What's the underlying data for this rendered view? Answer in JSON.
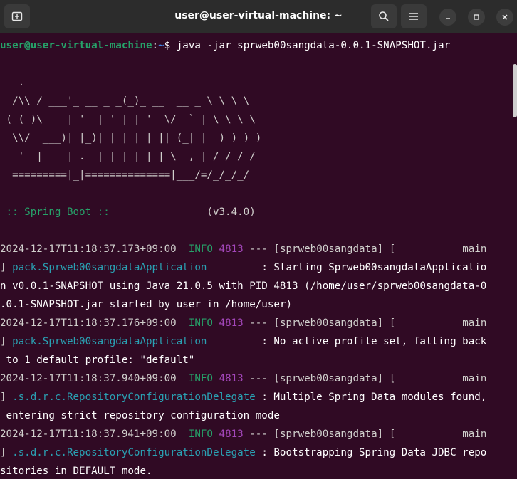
{
  "window": {
    "title": "user@user-virtual-machine: ~",
    "new_tab_icon": "new-tab-icon",
    "search_icon": "search-icon",
    "menu_icon": "hamburger-menu-icon",
    "min_icon": "minimize-icon",
    "max_icon": "maximize-icon",
    "close_icon": "close-icon"
  },
  "colors": {
    "background": "#300a24",
    "titlebar": "#2c2c2c",
    "prompt_user": "#26a269",
    "prompt_path": "#3f84e4",
    "info": "#26a269",
    "pid": "#a347ba",
    "logger": "#2aa1b3"
  },
  "prompt": {
    "user": "user@user-virtual-machine",
    "sep": ":",
    "path": "~",
    "symbol": "$ ",
    "command": "java -jar sprweb00sangdata-0.0.1-SNAPSHOT.jar"
  },
  "banner": [
    "   .   ____          _            __ _ _",
    "  /\\\\ / ___'_ __ _ _(_)_ __  __ _ \\ \\ \\ \\",
    " ( ( )\\___ | '_ | '_| | '_ \\/ _` | \\ \\ \\ \\",
    "  \\\\/  ___)| |_)| | | | | || (_| |  ) ) ) )",
    "   '  |____| .__|_| |_|_| |_\\__, | / / / /",
    "  =========|_|==============|___/=/_/_/_/"
  ],
  "spring_boot": {
    "label": " :: Spring Boot :: ",
    "pad": "              ",
    "version": " (v3.4.0)"
  },
  "logs": [
    {
      "ts": "2024-12-17T11:18:37.173+09:00",
      "level": "INFO",
      "pid": "4813",
      "mid": " --- [sprweb00sangdata] [           main",
      "cont_prefix": "] ",
      "logger": "pack.Sprweb00sangdataApplication",
      "logger_pad": "         ",
      "msg1": ": Starting Sprweb00sangdataApplicatio",
      "wrap": [
        "n v0.0.1-SNAPSHOT using Java 21.0.5 with PID 4813 (/home/user/sprweb00sangdata-0",
        ".0.1-SNAPSHOT.jar started by user in /home/user)"
      ]
    },
    {
      "ts": "2024-12-17T11:18:37.176+09:00",
      "level": "INFO",
      "pid": "4813",
      "mid": " --- [sprweb00sangdata] [           main",
      "cont_prefix": "] ",
      "logger": "pack.Sprweb00sangdataApplication",
      "logger_pad": "         ",
      "msg1": ": No active profile set, falling back",
      "wrap": [
        " to 1 default profile: \"default\""
      ]
    },
    {
      "ts": "2024-12-17T11:18:37.940+09:00",
      "level": "INFO",
      "pid": "4813",
      "mid": " --- [sprweb00sangdata] [           main",
      "cont_prefix": "] ",
      "logger": ".s.d.r.c.RepositoryConfigurationDelegate",
      "logger_pad": " ",
      "msg1": ": Multiple Spring Data modules found,",
      "wrap": [
        " entering strict repository configuration mode"
      ]
    },
    {
      "ts": "2024-12-17T11:18:37.941+09:00",
      "level": "INFO",
      "pid": "4813",
      "mid": " --- [sprweb00sangdata] [           main",
      "cont_prefix": "] ",
      "logger": ".s.d.r.c.RepositoryConfigurationDelegate",
      "logger_pad": " ",
      "msg1": ": Bootstrapping Spring Data JDBC repo",
      "wrap": [
        "sitories in DEFAULT mode."
      ]
    }
  ]
}
